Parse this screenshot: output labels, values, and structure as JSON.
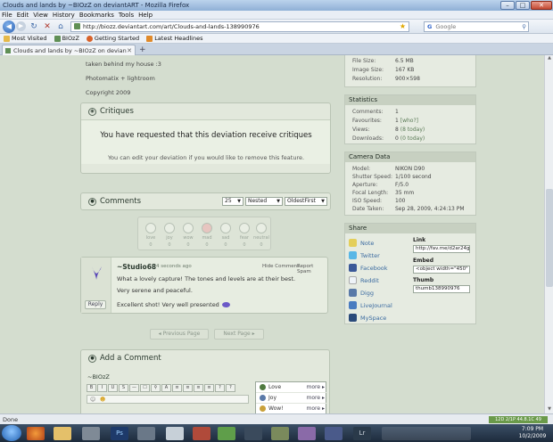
{
  "window": {
    "title": "Clouds and lands by ~BIOzZ on deviantART - Mozilla Firefox"
  },
  "menu": [
    "File",
    "Edit",
    "View",
    "History",
    "Bookmarks",
    "Tools",
    "Help"
  ],
  "nav": {
    "url": "http://biozz.deviantart.com/art/Clouds-and-lands-138990976",
    "search_placeholder": "Google"
  },
  "bookmarks": [
    "Most Visited",
    "BIOzZ",
    "Getting Started",
    "Latest Headlines"
  ],
  "tab": {
    "label": "Clouds and lands by ~BIOzZ on devian..."
  },
  "description": {
    "line1": "taken behind my house :3",
    "line2": "Photomatix + lightroom",
    "line3": "Copyright 2009"
  },
  "critiques": {
    "title": "Critiques",
    "message": "You have requested that this deviation receive critiques",
    "sub": "You can edit your deviation if you would like to remove this feature."
  },
  "comments": {
    "title": "Comments",
    "count_select": "25",
    "view_select": "Nested",
    "order_select": "OldestFirst",
    "moods": [
      {
        "name": "love",
        "count": "0"
      },
      {
        "name": "joy",
        "count": "0"
      },
      {
        "name": "wow",
        "count": "0"
      },
      {
        "name": "mad",
        "count": "0"
      },
      {
        "name": "sad",
        "count": "0"
      },
      {
        "name": "fear",
        "count": "0"
      },
      {
        "name": "neutral",
        "count": "0"
      }
    ],
    "entry": {
      "user": "~Studio68",
      "time": "4 seconds ago",
      "hide": "Hide Comment",
      "spam": "Report Spam",
      "line1": "What a lovely capture! The tones and levels are at their best.",
      "line2": "Very serene and peaceful.",
      "line3": "Excellent shot! Very well presented",
      "reply": "Reply"
    },
    "prev": "Previous Page",
    "next": "Next Page"
  },
  "add_comment": {
    "title": "Add a Comment",
    "username": "~BIOzZ",
    "tools": [
      "B",
      "I",
      "U",
      "S",
      "—",
      "☐",
      "⚲",
      "A",
      "≡",
      "≡",
      "≡",
      "≡",
      "?",
      "?"
    ],
    "moods": [
      {
        "label": "Love",
        "more": "more ▸"
      },
      {
        "label": "Joy",
        "more": "more ▸"
      },
      {
        "label": "Wow!",
        "more": "more ▸"
      }
    ]
  },
  "details": {
    "rows": [
      {
        "k": "File Size:",
        "v": "6.5 MB"
      },
      {
        "k": "Image Size:",
        "v": "167 KB"
      },
      {
        "k": "Resolution:",
        "v": "900×598"
      }
    ]
  },
  "statistics": {
    "title": "Statistics",
    "rows": [
      {
        "k": "Comments:",
        "v": "1",
        "x": ""
      },
      {
        "k": "Favourites:",
        "v": "1",
        "x": "[who?]"
      },
      {
        "k": "Views:",
        "v": "8",
        "x": "(8 today)"
      },
      {
        "k": "Downloads:",
        "v": "0",
        "x": "(0 today)"
      }
    ]
  },
  "camera": {
    "title": "Camera Data",
    "rows": [
      {
        "k": "Model:",
        "v": "NIKON D90"
      },
      {
        "k": "Shutter Speed:",
        "v": "1/100 second"
      },
      {
        "k": "Aperture:",
        "v": "F/5.0"
      },
      {
        "k": "Focal Length:",
        "v": "35 mm"
      },
      {
        "k": "ISO Speed:",
        "v": "100"
      },
      {
        "k": "Date Taken:",
        "v": "Sep 28, 2009, 4:24:13 PM"
      }
    ]
  },
  "share": {
    "title": "Share",
    "items": [
      "Note",
      "Twitter",
      "Facebook",
      "Reddit",
      "Digg",
      "LiveJournal",
      "MySpace"
    ],
    "link_label": "Link",
    "link_value": "http://fav.me/d2ar24g",
    "embed_label": "Embed",
    "embed_value": "<object width=\"450\" he",
    "thumb_label": "Thumb",
    "thumb_value": "thumb138990976"
  },
  "status": {
    "text": "Done",
    "right": "12D 2/1P 44.8.1C 49"
  },
  "clock": {
    "time": "7:09 PM",
    "date": "10/2/2009"
  },
  "colors": {
    "accent": "#3f6aa8",
    "page_bg": "#d4ddcf",
    "panel_bg": "#e2e8dc"
  }
}
